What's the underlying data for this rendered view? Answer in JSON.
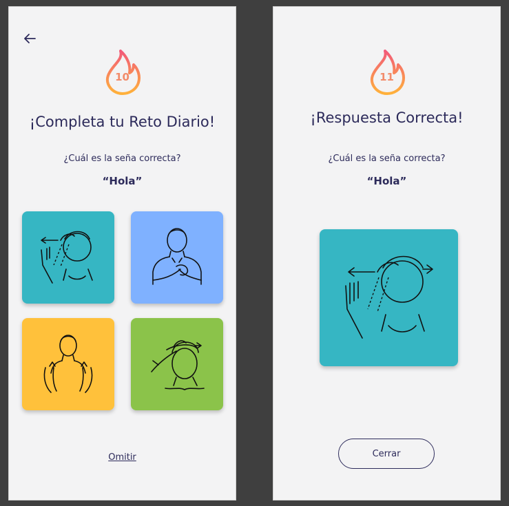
{
  "left_screen": {
    "streak_count": "10",
    "title": "¡Completa tu Reto Diario!",
    "question": "¿Cuál es la seña correcta?",
    "word": "“Hola”",
    "options": [
      {
        "icon": "sign-wave-hello-icon",
        "color": "#36b6c3"
      },
      {
        "icon": "sign-hands-chest-icon",
        "color": "#7fb1ff"
      },
      {
        "icon": "sign-hands-up-icon",
        "color": "#ffc13b"
      },
      {
        "icon": "sign-hand-forehead-icon",
        "color": "#8bc34a"
      }
    ],
    "skip_label": "Omitir"
  },
  "right_screen": {
    "streak_count": "11",
    "title": "¡Respuesta Correcta!",
    "question": "¿Cuál es la seña correcta?",
    "word": "“Hola”",
    "answer": {
      "icon": "sign-wave-hello-icon",
      "color": "#36b6c3"
    },
    "close_label": "Cerrar"
  },
  "colors": {
    "background": "#3f3f3f",
    "screen": "#f3f3f4",
    "text": "#2c2a5a",
    "flame_top": "#f25a7a",
    "flame_bottom": "#ffb13b"
  }
}
